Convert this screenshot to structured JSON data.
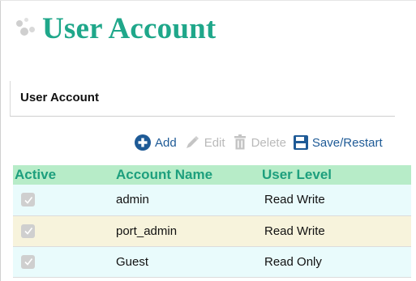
{
  "page": {
    "title": "User Account"
  },
  "section": {
    "label": "User Account"
  },
  "toolbar": {
    "add_label": "Add",
    "edit_label": "Edit",
    "delete_label": "Delete",
    "save_label": "Save/Restart",
    "icons": {
      "add": "plus-circle-icon",
      "edit": "pencil-icon",
      "delete": "trash-icon",
      "save": "floppy-disk-icon"
    }
  },
  "table": {
    "headers": {
      "active": "Active",
      "account_name": "Account Name",
      "user_level": "User Level"
    },
    "rows": [
      {
        "active": true,
        "account_name": "admin",
        "user_level": "Read Write"
      },
      {
        "active": true,
        "account_name": "port_admin",
        "user_level": "Read Write"
      },
      {
        "active": true,
        "account_name": "Guest",
        "user_level": "Read Only"
      }
    ]
  },
  "colors": {
    "title": "#1fa78a",
    "header_bg": "#b7ecc8",
    "header_text": "#1d9f7d",
    "row_even_bg": "#e9fbfc",
    "row_odd_bg": "#f7f3dc",
    "toolbar_active": "#1e5a96",
    "toolbar_disabled": "#b9b9b9"
  }
}
